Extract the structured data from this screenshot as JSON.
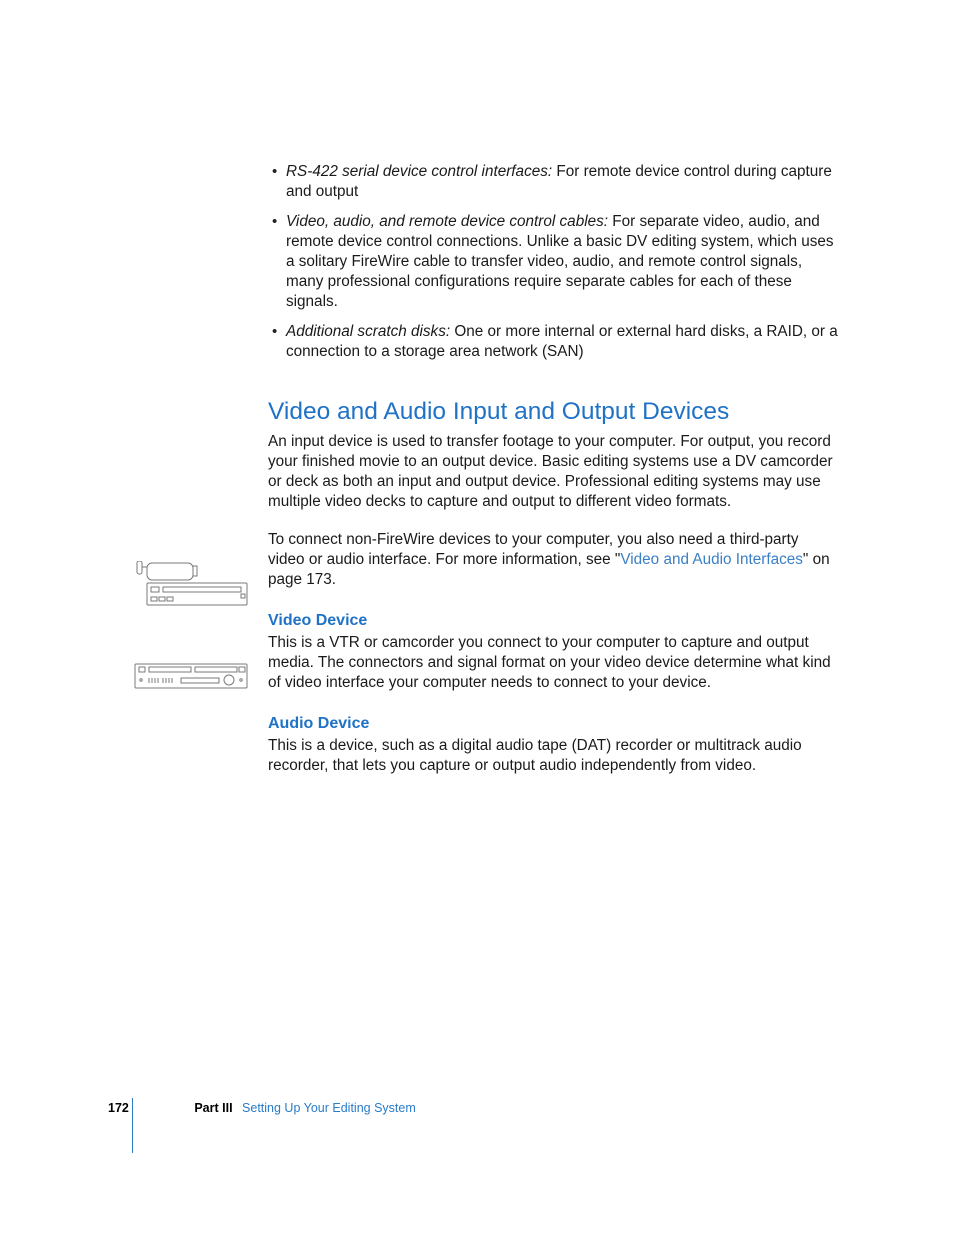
{
  "bullets": [
    {
      "term": "RS-422 serial device control interfaces:",
      "rest": "  For remote device control during capture and output"
    },
    {
      "term": "Video, audio, and remote device control cables:",
      "rest": "  For separate video, audio, and remote device control connections. Unlike a basic DV editing system, which uses a solitary FireWire cable to transfer video, audio, and remote control signals, many professional configurations require separate cables for each of these signals."
    },
    {
      "term": "Additional scratch disks:",
      "rest": "  One or more internal or external hard disks, a RAID, or a connection to a storage area network (SAN)"
    }
  ],
  "section_heading": "Video and Audio Input and Output Devices",
  "intro_para": "An input device is used to transfer footage to your computer. For output, you record your finished movie to an output device. Basic editing systems use a DV camcorder or deck as both an input and output device. Professional editing systems may use multiple video decks to capture and output to different video formats.",
  "connect_para_a": "To connect non-FireWire devices to your computer, you also need a third-party video or audio interface. For more information, see \"",
  "connect_xref": "Video and Audio Interfaces",
  "connect_para_b": "\" on page 173.",
  "video_heading": "Video Device",
  "video_body": "This is a VTR or camcorder you connect to your computer to capture and output media. The connectors and signal format on your video device determine what kind of video interface your computer needs to connect to your device.",
  "audio_heading": "Audio Device",
  "audio_body": "This is a device, such as a digital audio tape (DAT) recorder or multitrack audio recorder, that lets you capture or output audio independently from video.",
  "footer": {
    "page": "172",
    "part": "Part III",
    "title": "Setting Up Your Editing System"
  }
}
